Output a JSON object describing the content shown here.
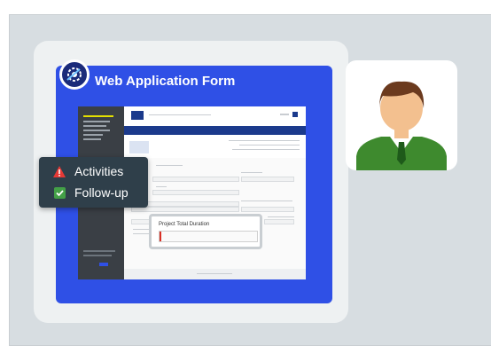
{
  "header": {
    "title": "Web Application Form",
    "logo_icon": "application-gear-icon"
  },
  "overlay_menu": {
    "items": [
      {
        "label": "Activities",
        "icon": "warning-icon",
        "icon_color": "#e53935"
      },
      {
        "label": "Follow-up",
        "icon": "checkbox-icon",
        "icon_color": "#43a047"
      }
    ]
  },
  "popup": {
    "label": "Project Total Duration",
    "value": ""
  },
  "colors": {
    "panel_blue": "#2f50e6",
    "menu_bg": "#2f3f4a",
    "shirt_green": "#3e8a2e"
  },
  "avatar": {
    "icon": "user-avatar-icon"
  }
}
